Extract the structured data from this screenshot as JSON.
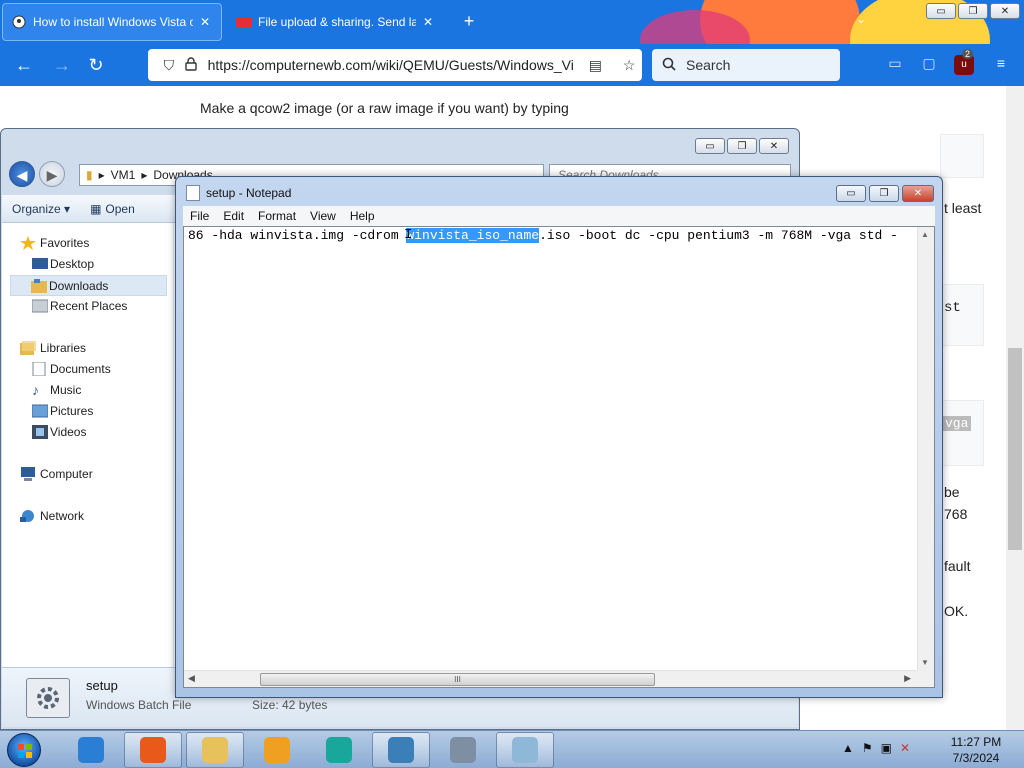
{
  "browser": {
    "tabs": [
      {
        "title": "How to install Windows Vista o",
        "active": true,
        "icon": "wiki-icon"
      },
      {
        "title": "File upload & sharing. Send larg",
        "active": false,
        "icon": "mail-icon"
      }
    ],
    "new_tab": "+",
    "url": "https://computernewb.com/wiki/QEMU/Guests/Windows_Vi",
    "search_placeholder": "Search",
    "ublock_count": "2",
    "window_controls": {
      "minimize": "▭",
      "restore": "❐",
      "close": "✕"
    }
  },
  "page": {
    "paragraph": "Make a qcow2 image (or a raw image if you want) by typing",
    "fragments": {
      "least": "t least",
      "st": "st",
      "vga": "vga",
      "be": "be",
      "n768": "768",
      "fault": "fault",
      "ok": "OK."
    }
  },
  "explorer": {
    "breadcrumb": [
      "VM1",
      "Downloads"
    ],
    "search_placeholder": "Search Downloads",
    "toolbar": {
      "organize": "Organize ▾",
      "open": "Open"
    },
    "sidebar": {
      "favorites": "Favorites",
      "favorites_items": [
        "Desktop",
        "Downloads",
        "Recent Places"
      ],
      "libraries": "Libraries",
      "libraries_items": [
        "Documents",
        "Music",
        "Pictures",
        "Videos"
      ],
      "computer": "Computer",
      "network": "Network"
    },
    "status": {
      "name": "setup",
      "type": "Windows Batch File",
      "size": "Size: 42 bytes"
    }
  },
  "notepad": {
    "title": "setup - Notepad",
    "menu": [
      "File",
      "Edit",
      "Format",
      "View",
      "Help"
    ],
    "line_before": "86 -hda winvista.img -cdrom ",
    "line_selected": "winvista_iso_name",
    "line_after": ".iso -boot dc -cpu pentium3 -m 768M -vga std -",
    "hscroll_grip": "III"
  },
  "taskbar": {
    "apps": [
      {
        "name": "ie-icon",
        "color": "#2a7fd4",
        "open": false
      },
      {
        "name": "firefox-icon",
        "color": "#e8591a",
        "open": true
      },
      {
        "name": "explorer-icon",
        "color": "#e6c15c",
        "open": true
      },
      {
        "name": "media-player-icon",
        "color": "#f0a020",
        "open": false
      },
      {
        "name": "teal-app-icon",
        "color": "#1aa79b",
        "open": false
      },
      {
        "name": "picture-viewer-icon",
        "color": "#3a7fb8",
        "open": true
      },
      {
        "name": "tools-icon",
        "color": "#7e8ea3",
        "open": false
      },
      {
        "name": "notepad-icon",
        "color": "#8fb7d8",
        "open": true
      }
    ],
    "time": "11:27 PM",
    "date": "7/3/2024"
  }
}
